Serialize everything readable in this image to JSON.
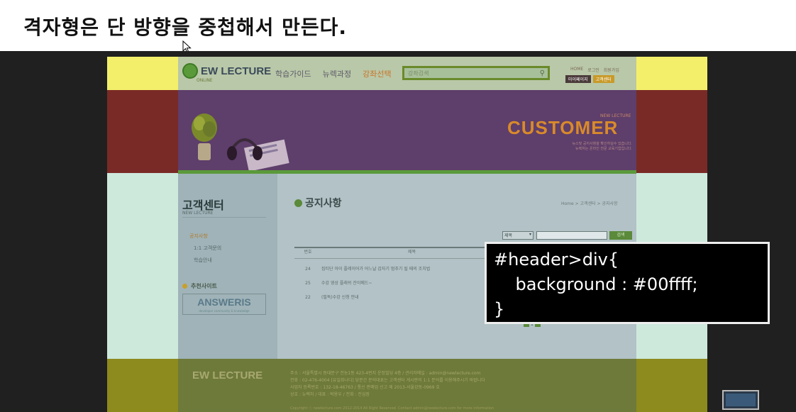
{
  "slide": {
    "title": "격자형은 단 방향을 중첩해서 만든다."
  },
  "site": {
    "logo": "EW LECTURE",
    "logo_sub": "ONLINE",
    "gnb": [
      "학습가이드",
      "뉴렉과정",
      "강좌선택"
    ],
    "search_placeholder": "강좌검색",
    "util_links": [
      "HOME",
      "로그인",
      "회원가입"
    ],
    "util_buttons": [
      "마이페이지",
      "고객센터"
    ],
    "visual_small": "NEW LECTURE",
    "visual_title": "CUSTOMER",
    "visual_desc": [
      "뉴스및 공지사항을 확인하실수 있습니다.",
      "뉴렉처는 온라인 전문 교육기업입니다."
    ],
    "lnb": {
      "title": "고객센터",
      "subtitle": "NEW LECTURE",
      "items": [
        "공지사항",
        "1:1 고객문의",
        "학습안내"
      ],
      "recommend": "추천사이트",
      "banner": "ANSWERIS",
      "banner_sub": "developer community & knowledge"
    },
    "board": {
      "title": "공지사항",
      "breadcrumb": "Home > 고객센터 > 공지사항",
      "select_value": "제목",
      "search_button": "검색",
      "headers": [
        "번호",
        "제목"
      ],
      "rows": [
        {
          "num": "24",
          "title": "집티단 아이 플레이어가 어느날 갑자기 멈추기 될 때의 조치법"
        },
        {
          "num": "25",
          "title": "수강 영상 플래쉬 잔이메드~"
        },
        {
          "num": "22",
          "title": "(필독)수강 신청 안내"
        }
      ],
      "page": "1"
    },
    "footer": {
      "logo": "EW LECTURE",
      "address": "주소 : 서울특별시 동대문구 전농1동 423-4번지 운정빌딩 4층 / 관리자메일 : admin@newlecture.com",
      "tel": "전화 : 02-476-4004 [유일회나디] 당분간 문의대표는 고객센터 게시판의 1:1 문의를 이용해주시기 바랍니다",
      "biz": "사업자 등록번호 : 132-18-46763 / 통신 판매업 신고 제 2013-서울강동-0969 호",
      "rep": "상호 : 뉴렉처 / 대표 : 박용우 / 전화 : 전심장",
      "copyright": "Copyright ⓒ newlecture.com 2012-2014 All Right Reserved. Contact admin@newlecture.com for more information"
    }
  },
  "code": {
    "lines": [
      "#header>div{",
      "    background : #00ffff;",
      "}"
    ]
  }
}
